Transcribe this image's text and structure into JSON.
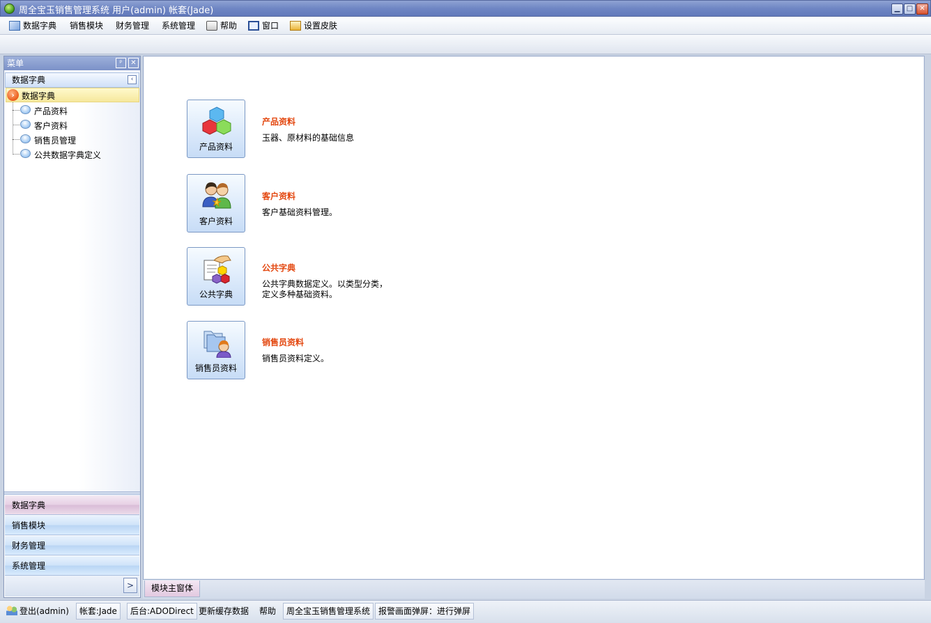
{
  "window": {
    "title": "周全宝玉销售管理系统 用户(admin) 帐套(Jade)",
    "buttons": {
      "minimize": "▁",
      "maximize": "□",
      "close": "✕"
    }
  },
  "menubar": {
    "items": [
      {
        "label": "数据字典",
        "icon": "dictionary-icon"
      },
      {
        "label": "销售模块"
      },
      {
        "label": "财务管理"
      },
      {
        "label": "系统管理"
      },
      {
        "label": "帮助",
        "icon": "help-icon"
      },
      {
        "label": "窗口",
        "icon": "window-icon"
      },
      {
        "label": "设置皮肤",
        "icon": "skin-icon"
      }
    ]
  },
  "sidebar": {
    "title": "菜单",
    "pin": "ᵖ",
    "close": "✕",
    "group": "数据字典",
    "collapse": "‹",
    "tree": {
      "root": "数据字典",
      "root_arrow": "›",
      "children": [
        "产品资料",
        "客户资料",
        "销售员管理",
        "公共数据字典定义"
      ]
    },
    "nav": [
      "数据字典",
      "销售模块",
      "财务管理",
      "系统管理"
    ],
    "more": ">"
  },
  "main": {
    "modules": [
      {
        "tile": "产品资料",
        "title": "产品资料",
        "desc": "玉器、原材料的基础信息",
        "icon": "cubes-icon"
      },
      {
        "tile": "客户资料",
        "title": "客户资料",
        "desc": "客户基础资料管理。",
        "icon": "customers-icon"
      },
      {
        "tile": "公共字典",
        "title": "公共字典",
        "desc": "公共字典数据定义。以类型分类，\n定义多种基础资料。",
        "icon": "dictionary-hand-icon"
      },
      {
        "tile": "销售员资料",
        "title": "销售员资料",
        "desc": "销售员资料定义。",
        "icon": "salesperson-icon"
      }
    ]
  },
  "tabs": {
    "active": "模块主窗体"
  },
  "statusbar": {
    "logout": "登出(admin)",
    "account": "帐套:Jade",
    "backend": "后台:ADODirect",
    "refresh": "更新缓存数据",
    "help": "帮助",
    "system": "周全宝玉销售管理系统",
    "alarm": "报警画面弹屏：进行弹屏"
  },
  "colors": {
    "accent_title": "#e3470f",
    "titlebar": "#6f86c4",
    "selected_row": "#f6e89c"
  }
}
